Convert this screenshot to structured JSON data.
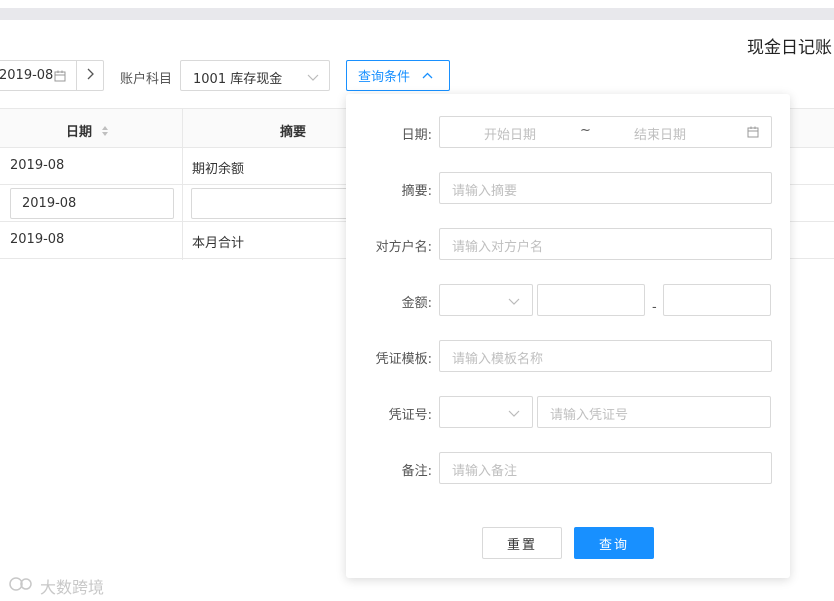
{
  "page": {
    "title": "现金日记账"
  },
  "toolbar": {
    "date_value": "2019-08",
    "account_label": "账户科目",
    "account_value": "1001 库存现金",
    "query_button_label": "查询条件"
  },
  "table": {
    "headers": [
      "日期",
      "摘要"
    ],
    "rows": [
      {
        "date": "2019-08",
        "summary": "期初余额"
      },
      {
        "date": "2019-08",
        "summary": ""
      },
      {
        "date": "2019-08",
        "summary": "本月合计"
      }
    ]
  },
  "filter_panel": {
    "date_label": "日期:",
    "start_date_placeholder": "开始日期",
    "range_separator": "~",
    "end_date_placeholder": "结束日期",
    "summary_label": "摘要:",
    "summary_placeholder": "请输入摘要",
    "counterparty_label": "对方户名:",
    "counterparty_placeholder": "请输入对方户名",
    "amount_label": "金额:",
    "amount_dash": "-",
    "template_label": "凭证模板:",
    "template_placeholder": "请输入模板名称",
    "voucher_label": "凭证号:",
    "voucher_placeholder": "请输入凭证号",
    "remark_label": "备注:",
    "remark_placeholder": "请输入备注",
    "reset_label": "重置",
    "query_label": "查询"
  },
  "watermark": {
    "text": "大数跨境"
  },
  "colors": {
    "accent": "#1890ff",
    "border": "#d9d9d9",
    "placeholder": "#bfbfbf"
  }
}
